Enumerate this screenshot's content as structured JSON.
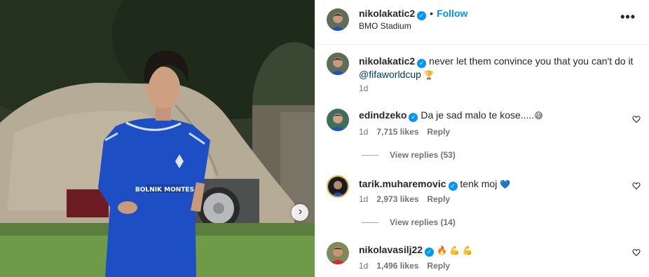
{
  "post": {
    "username": "nikolakatic2",
    "follow_label": "Follow",
    "location": "BMO Stadium",
    "more_label": "•••",
    "caption_text": "never let them convince you that you can't do it",
    "caption_mention": "@fifaworldcup",
    "caption_emoji": "🏆",
    "caption_time": "1d"
  },
  "comments": [
    {
      "username": "edindzeko",
      "text": "Da je sad malo te kose.....",
      "emoji": "😅",
      "time": "1d",
      "likes": "7,715 likes",
      "reply_label": "Reply",
      "view_replies": "View replies (53)"
    },
    {
      "username": "tarik.muharemovic",
      "text": "tenk moj",
      "emoji": "💙",
      "time": "1d",
      "likes": "2,973 likes",
      "reply_label": "Reply",
      "view_replies": "View replies (14)"
    },
    {
      "username": "nikolavasilj22",
      "text": "",
      "emoji": "🔥 💪 💪",
      "time": "1d",
      "likes": "1,496 likes",
      "reply_label": "Reply"
    }
  ],
  "jersey_text": "BOLNIK MONTES",
  "colors": {
    "verified": "#0095f6",
    "follow": "#0095f6",
    "mention": "#00376b",
    "muted": "#737373"
  },
  "icons": [
    "verified-badge-icon",
    "more-options-icon",
    "heart-icon",
    "chevron-right-icon"
  ]
}
